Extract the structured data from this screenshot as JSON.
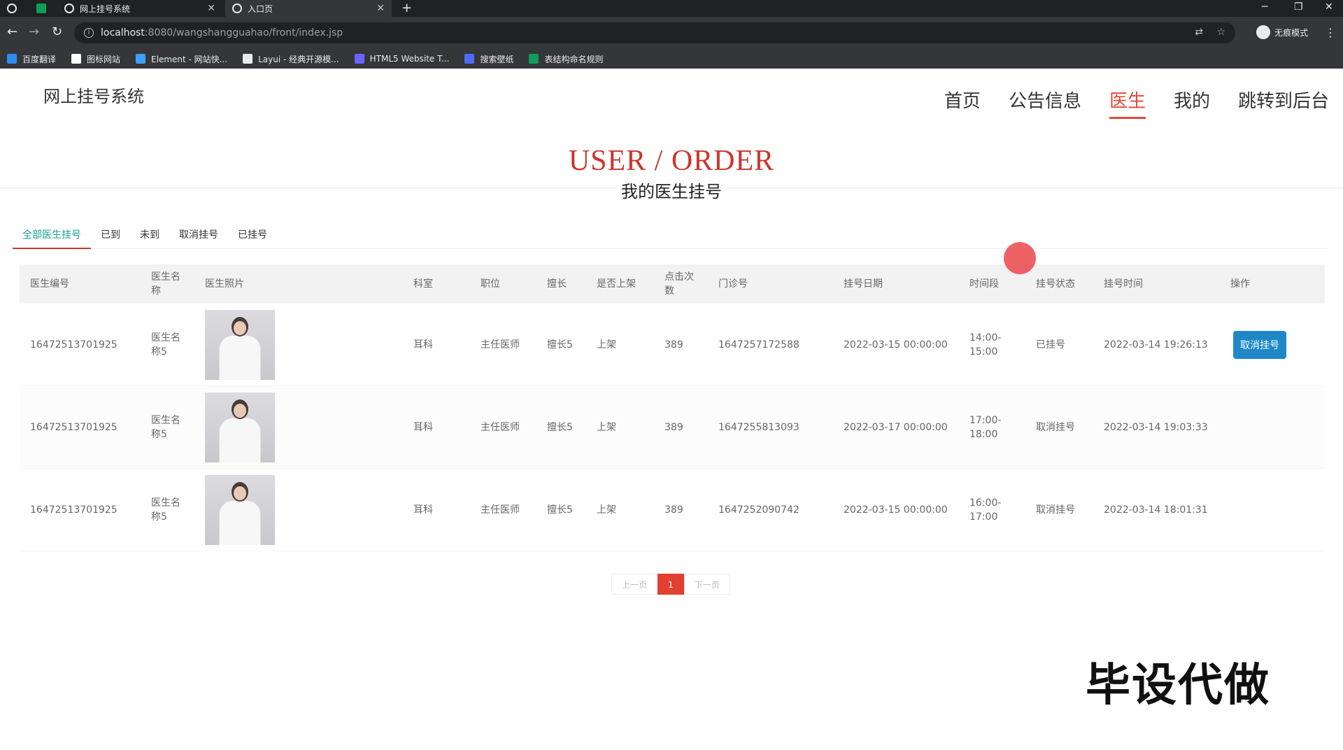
{
  "browser": {
    "tabs": [
      {
        "title": "",
        "active": false
      },
      {
        "title": "",
        "active": false
      },
      {
        "title": "网上挂号系统",
        "active": false
      },
      {
        "title": "入口页",
        "active": true
      }
    ],
    "url_host": "localhost",
    "url_path": ":8080/wangshangguahao/front/index.jsp",
    "incognito_label": "无痕模式",
    "bookmarks": [
      {
        "label": "百度翻译",
        "color": "#2d8cf0"
      },
      {
        "label": "图标网站",
        "color": "#ffffff"
      },
      {
        "label": "Element - 网站快...",
        "color": "#409eff"
      },
      {
        "label": "Layui - 经典开源模...",
        "color": "#e8eaed"
      },
      {
        "label": "HTML5 Website T...",
        "color": "#6c63ff"
      },
      {
        "label": "搜索壁纸",
        "color": "#4a6cf7"
      },
      {
        "label": "表结构命名规则",
        "color": "#0f9d58"
      }
    ]
  },
  "site": {
    "title": "网上挂号系统",
    "nav": [
      {
        "label": "首页",
        "active": false
      },
      {
        "label": "公告信息",
        "active": false
      },
      {
        "label": "医生",
        "active": true
      },
      {
        "label": "我的",
        "active": false
      },
      {
        "label": "跳转到后台",
        "active": false
      }
    ]
  },
  "banner": {
    "en": "USER / ORDER",
    "zh": "我的医生挂号"
  },
  "filter_tabs": [
    {
      "label": "全部医生挂号",
      "active": true
    },
    {
      "label": "已到",
      "active": false
    },
    {
      "label": "未到",
      "active": false
    },
    {
      "label": "取消挂号",
      "active": false
    },
    {
      "label": "已挂号",
      "active": false
    }
  ],
  "table": {
    "headers": [
      "医生编号",
      "医生名称",
      "医生照片",
      "科室",
      "职位",
      "擅长",
      "是否上架",
      "点击次数",
      "门诊号",
      "挂号日期",
      "时间段",
      "挂号状态",
      "挂号时间",
      "操作"
    ],
    "rows": [
      {
        "doctor_id": "16472513701925",
        "doctor_name": "医生名称5",
        "department": "耳科",
        "position": "主任医师",
        "specialty": "擅长5",
        "listed": "上架",
        "clicks": "389",
        "clinic_no": "1647257172588",
        "date": "2022-03-15 00:00:00",
        "slot": "14:00-15:00",
        "status": "已挂号",
        "created": "2022-03-14 19:26:13",
        "action": "取消挂号"
      },
      {
        "doctor_id": "16472513701925",
        "doctor_name": "医生名称5",
        "department": "耳科",
        "position": "主任医师",
        "specialty": "擅长5",
        "listed": "上架",
        "clicks": "389",
        "clinic_no": "1647255813093",
        "date": "2022-03-17 00:00:00",
        "slot": "17:00-18:00",
        "status": "取消挂号",
        "created": "2022-03-14 19:03:33",
        "action": ""
      },
      {
        "doctor_id": "16472513701925",
        "doctor_name": "医生名称5",
        "department": "耳科",
        "position": "主任医师",
        "specialty": "擅长5",
        "listed": "上架",
        "clicks": "389",
        "clinic_no": "1647252090742",
        "date": "2022-03-15 00:00:00",
        "slot": "16:00-17:00",
        "status": "取消挂号",
        "created": "2022-03-14 18:01:31",
        "action": ""
      }
    ]
  },
  "pagination": {
    "prev": "上一页",
    "current": "1",
    "next": "下一页"
  },
  "watermark": "毕设代做"
}
